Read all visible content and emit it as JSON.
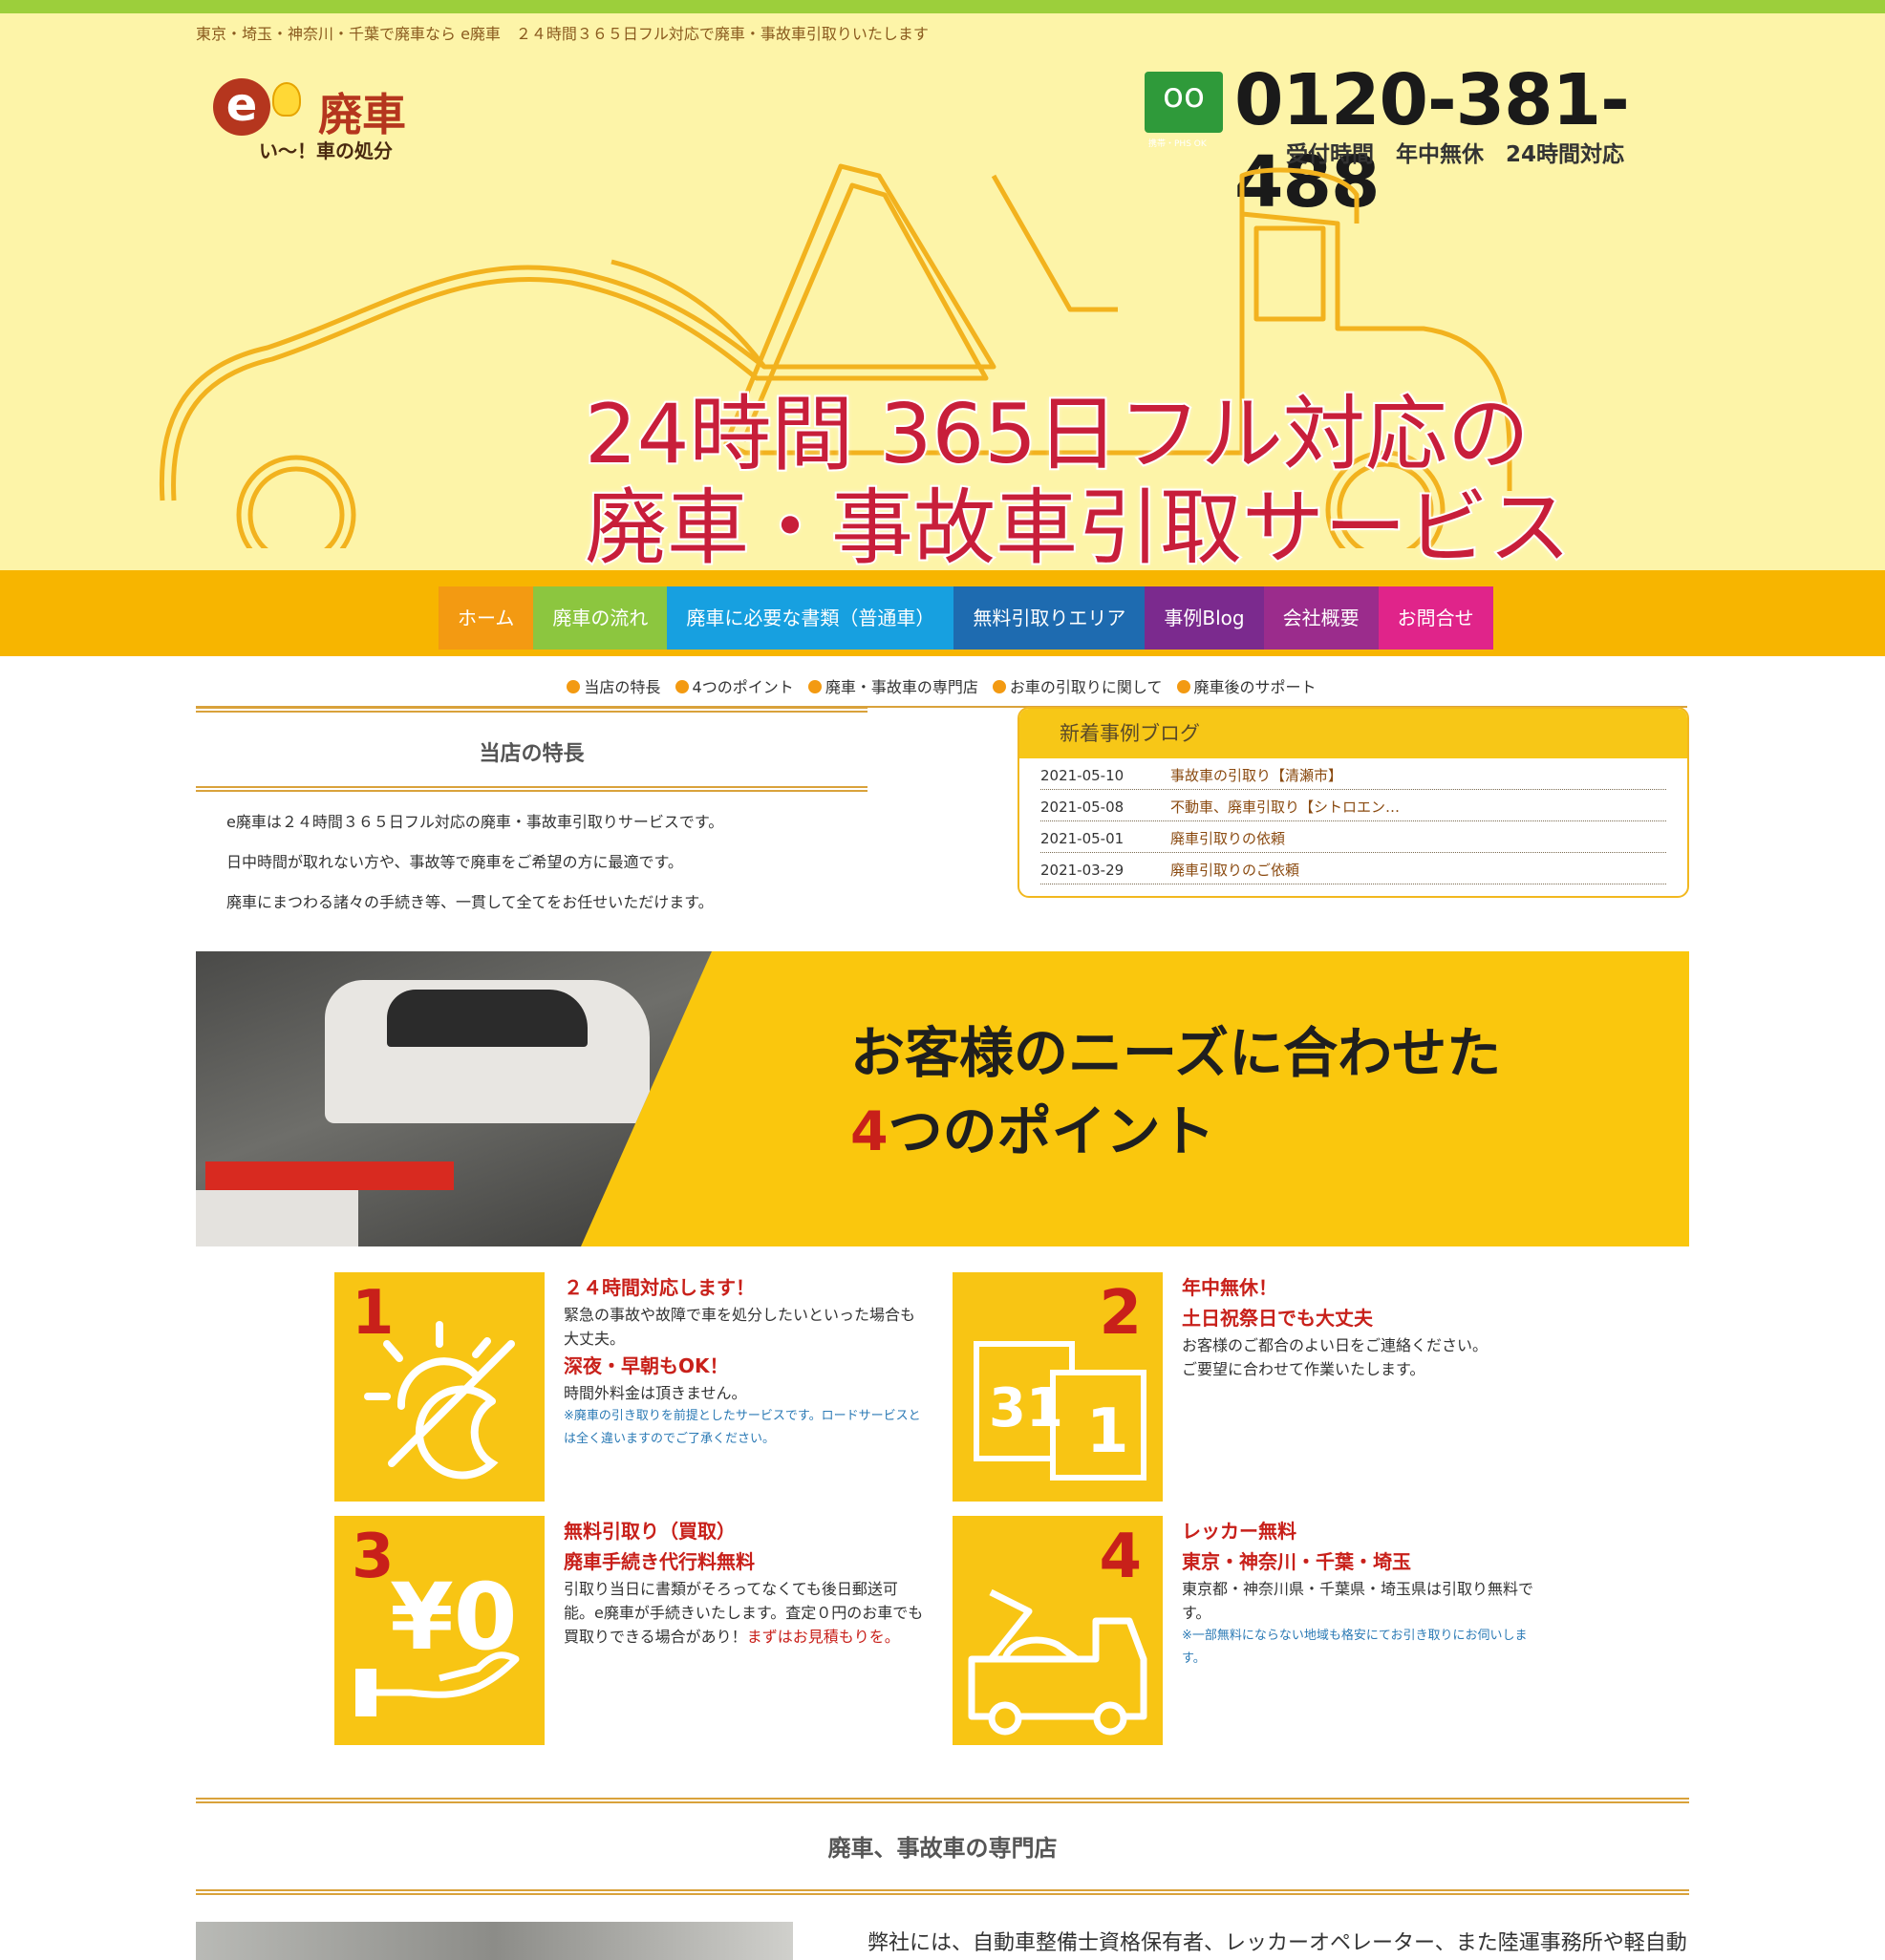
{
  "header": {
    "tagline": "東京・埼玉・神奈川・千葉で廃車なら e廃車　２４時間３６５日フル対応で廃車・事故車引取りいたします",
    "logo_letter": "e",
    "logo_title": "廃車",
    "logo_sub": "い〜！車の処分",
    "freedial_icon": "freedial-icon",
    "freedial_note": "携帯・PHS OK",
    "phone": "0120-381-488",
    "hours": "受付時間　年中無休　24時間対応"
  },
  "hero": {
    "line1": "24時間 365日フル対応の",
    "line2": "廃車・事故車引取サービス"
  },
  "nav": [
    {
      "label": "ホーム",
      "color": "#f39a12"
    },
    {
      "label": "廃車の流れ",
      "color": "#8cc63f"
    },
    {
      "label": "廃車に必要な書類（普通車）",
      "color": "#17a0e0"
    },
    {
      "label": "無料引取りエリア",
      "color": "#1e6bb0"
    },
    {
      "label": "事例Blog",
      "color": "#7b2a8e"
    },
    {
      "label": "会社概要",
      "color": "#9b2c8c"
    },
    {
      "label": "お問合せ",
      "color": "#e0248a"
    }
  ],
  "subnav": [
    "当店の特長",
    "4つのポイント",
    "廃車・事故車の専門店",
    "お車の引取りに関して",
    "廃車後のサポート"
  ],
  "features": {
    "title": "当店の特長",
    "lines": [
      "e廃車は２４時間３６５日フル対応の廃車・事故車引取りサービスです。",
      "日中時間が取れない方や、事故等で廃車をご希望の方に最適です。",
      "廃車にまつわる諸々の手続き等、一貫して全てをお任せいただけます。"
    ]
  },
  "blog": {
    "title": "新着事例ブログ",
    "posts": [
      {
        "date": "2021-05-10",
        "title": "事故車の引取り【清瀬市】"
      },
      {
        "date": "2021-05-08",
        "title": "不動車、廃車引取り【シトロエン…"
      },
      {
        "date": "2021-05-01",
        "title": "廃車引取りの依頼"
      },
      {
        "date": "2021-03-29",
        "title": "廃車引取りのご依頼"
      }
    ]
  },
  "banner": {
    "line1": "お客様のニーズに合わせた",
    "num": "4",
    "line2": "つのポイント"
  },
  "points": {
    "p1": {
      "num": "1",
      "h1": "２４時間対応します！",
      "t1": "緊急の事故や故障で車を処分したいといった場合も大丈夫。",
      "h2": "深夜・早朝もOK！",
      "t2": "時間外料金は頂きません。",
      "note": "※廃車の引き取りを前提としたサービスです。ロードサービスとは全く違いますのでご了承ください。"
    },
    "p2": {
      "num": "2",
      "h1": "年中無休！",
      "h2": "土日祝祭日でも大丈夫",
      "t1": "お客様のご都合のよい日をご連絡ください。",
      "t2": "ご要望に合わせて作業いたします。",
      "cal1": "31",
      "cal2": "1"
    },
    "p3": {
      "num": "3",
      "h1": "無料引取り（買取）",
      "h2": "廃車手続き代行料無料",
      "t1": "引取り当日に書類がそろってなくても後日郵送可能。e廃車が手続きいたします。査定０円のお車でも買取りできる場合があり！",
      "t1_red": "まずはお見積もりを。",
      "yen": "¥0"
    },
    "p4": {
      "num": "4",
      "h1": "レッカー無料",
      "h2": "東京・神奈川・千葉・埼玉",
      "t1": "東京都・神奈川県・千葉県・埼玉県は引取り無料です。",
      "note": "※一部無料にならない地域も格安にてお引き取りにお伺いします。"
    }
  },
  "section2": {
    "title": "廃車、事故車の専門店",
    "text": "弊社には、自動車整備士資格保有者、レッカーオペレーター、また陸運事務所や軽自動"
  }
}
